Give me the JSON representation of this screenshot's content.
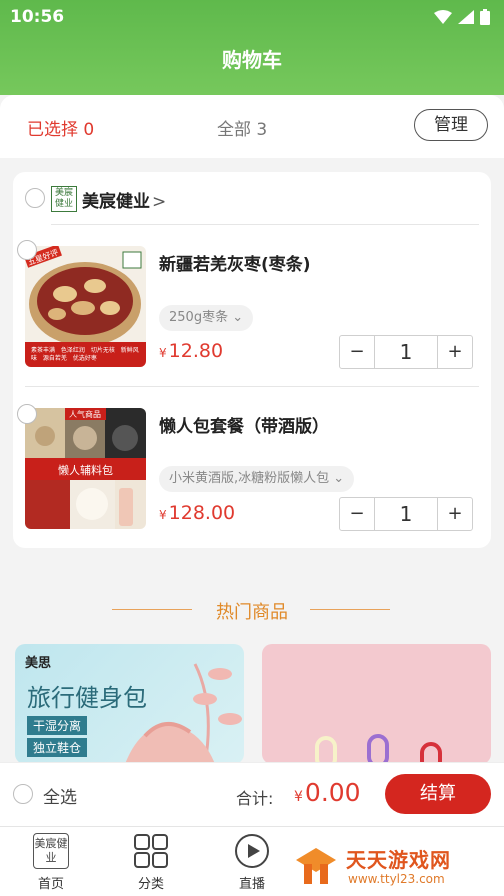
{
  "status": {
    "time": "10:56"
  },
  "header": {
    "title": "购物车"
  },
  "summary": {
    "selected": "已选择 0",
    "all": "全部 3",
    "manage": "管理"
  },
  "store": {
    "logo_text": "美宸健业",
    "name": "美宸健业",
    "chevron": ">"
  },
  "items": [
    {
      "title": "新疆若羌灰枣(枣条)",
      "spec": "250g枣条",
      "price": "12.80",
      "qty": "1",
      "thumb_tag": "五星好评",
      "thumb_captions": "素茶丰满 色泽红润 切片无核 新鲜风味 源自若羌 优选好枣"
    },
    {
      "title": "懒人包套餐（带酒版）",
      "spec": "小米黄酒版,冰糖粉版懒人包",
      "price": "128.00",
      "qty": "1",
      "thumb_tag": "人气商品",
      "thumb_banner": "懒人辅料包"
    }
  ],
  "currency": "¥",
  "stepper": {
    "minus": "−",
    "plus": "+"
  },
  "hot": {
    "title": "热门商品",
    "card1": {
      "logo": "美思",
      "headline": "旅行健身包",
      "tag1": "干湿分离",
      "tag2": "独立鞋仓"
    }
  },
  "checkout": {
    "select_all": "全选",
    "total_label": "合计:",
    "total": "0.00",
    "button": "结算"
  },
  "tabs": [
    {
      "label": "首页",
      "icon_text": "美宸健业"
    },
    {
      "label": "分类"
    },
    {
      "label": "直播"
    }
  ],
  "watermark": {
    "text": "天天游戏网",
    "url": "www.ttyl23.com"
  },
  "colors": {
    "brand_green": "#5fb94c",
    "accent_red": "#e03a2f",
    "button_red": "#d4261f",
    "hot_orange": "#e08a2a"
  }
}
